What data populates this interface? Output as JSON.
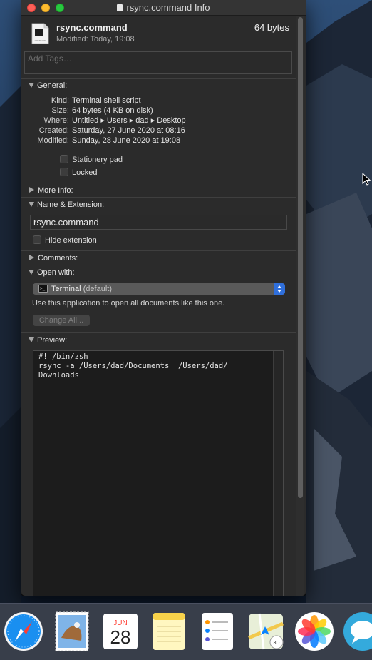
{
  "window": {
    "title": "rsync.command Info"
  },
  "header": {
    "file_name": "rsync.command",
    "file_size": "64 bytes",
    "modified_line": "Modified: Today, 19:08",
    "tags_placeholder": "Add Tags…",
    "icon_label": "COMMAND"
  },
  "general": {
    "title": "General:",
    "rows": [
      {
        "key": "Kind:",
        "value": "Terminal shell script"
      },
      {
        "key": "Size:",
        "value": "64 bytes (4 KB on disk)"
      },
      {
        "key": "Where:",
        "value": "Untitled ▸ Users ▸ dad ▸ Desktop"
      },
      {
        "key": "Created:",
        "value": "Saturday, 27 June 2020 at 08:16"
      },
      {
        "key": "Modified:",
        "value": "Sunday, 28 June 2020 at 19:08"
      }
    ],
    "stationery_label": "Stationery pad",
    "locked_label": "Locked",
    "stationery_checked": false,
    "locked_checked": false
  },
  "more_info": {
    "title": "More Info:"
  },
  "name_extension": {
    "title": "Name & Extension:",
    "name_value": "rsync.command",
    "hide_extension_label": "Hide extension",
    "hide_extension_checked": false
  },
  "comments": {
    "title": "Comments:"
  },
  "open_with": {
    "title": "Open with:",
    "app_name": "Terminal",
    "app_default": "(default)",
    "use_text": "Use this application to open all documents like this one.",
    "change_all_label": "Change All..."
  },
  "preview": {
    "title": "Preview:",
    "content": "#! /bin/zsh\nrsync -a /Users/dad/Documents  /Users/dad/\nDownloads"
  },
  "dock": {
    "calendar_month": "JUN",
    "calendar_day": "28",
    "maps_badge": "3D",
    "items": [
      "Safari",
      "Mail",
      "Calendar",
      "Notes",
      "Reminders",
      "Maps",
      "Photos",
      "Messages"
    ]
  },
  "colors": {
    "accent": "#2f6fdc",
    "window_bg": "#2b2b2b",
    "close": "#fe5f57",
    "minimize": "#febc2e",
    "zoom": "#28c840"
  }
}
